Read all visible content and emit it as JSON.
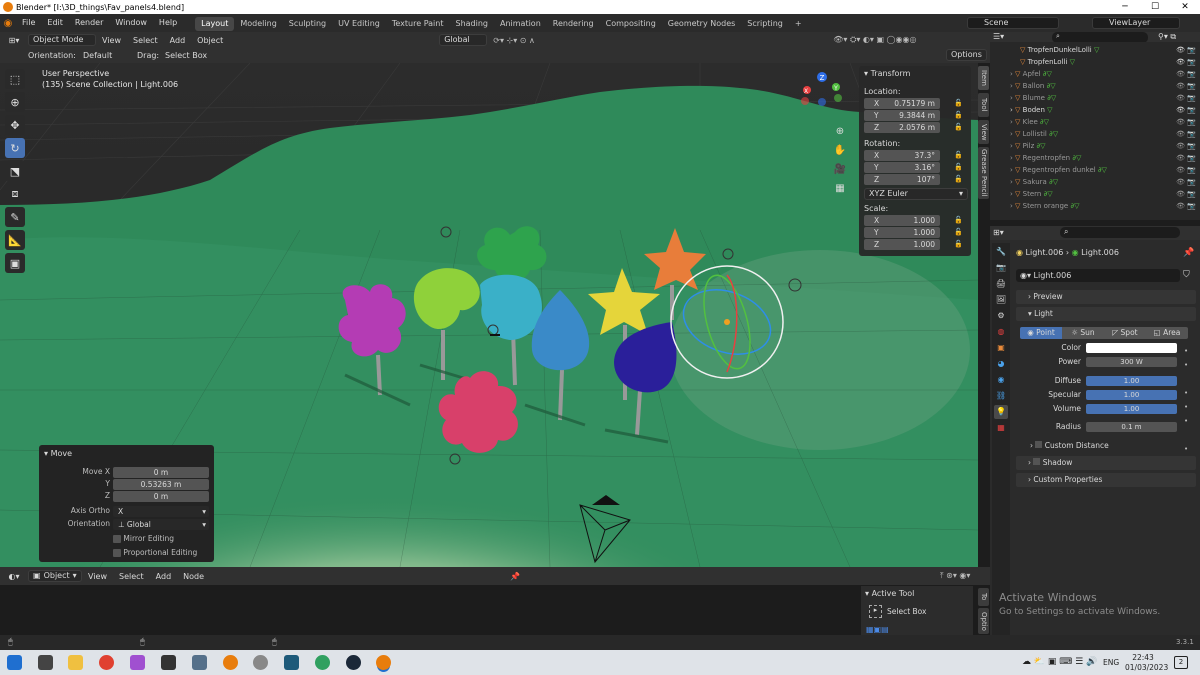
{
  "window": {
    "title": "Blender* [I:\\3D_things\\Fav_panels4.blend]",
    "minimize": "─",
    "maximize": "☐",
    "close": "✕"
  },
  "menu": [
    "File",
    "Edit",
    "Render",
    "Window",
    "Help"
  ],
  "workspaces": [
    "Layout",
    "Modeling",
    "Sculpting",
    "UV Editing",
    "Texture Paint",
    "Shading",
    "Animation",
    "Rendering",
    "Compositing",
    "Geometry Nodes",
    "Scripting"
  ],
  "active_workspace": "Layout",
  "add_workspace": "+",
  "scene": {
    "label": "Scene",
    "view_layer": "ViewLayer"
  },
  "viewport_header": {
    "mode": "Object Mode",
    "menus": [
      "View",
      "Select",
      "Add",
      "Object"
    ],
    "transform_orientation": "Global"
  },
  "viewport_header2": {
    "orientation_label": "Orientation:",
    "orientation_value": "Default",
    "drag_label": "Drag:",
    "drag_value": "Select Box",
    "options": "Options"
  },
  "viewport_info": {
    "line1": "User Perspective",
    "line2": "(135) Scene Collection | Light.006"
  },
  "gizmo_axes": {
    "x": "X",
    "y": "Y",
    "z": "Z"
  },
  "transform": {
    "title": "Transform",
    "location_label": "Location:",
    "location": [
      {
        "axis": "X",
        "value": "0.75179 m"
      },
      {
        "axis": "Y",
        "value": "9.3844 m"
      },
      {
        "axis": "Z",
        "value": "2.0576 m"
      }
    ],
    "rotation_label": "Rotation:",
    "rotation": [
      {
        "axis": "X",
        "value": "37.3°"
      },
      {
        "axis": "Y",
        "value": "3.16°"
      },
      {
        "axis": "Z",
        "value": "107°"
      }
    ],
    "rotation_mode": "XYZ Euler",
    "scale_label": "Scale:",
    "scale": [
      {
        "axis": "X",
        "value": "1.000"
      },
      {
        "axis": "Y",
        "value": "1.000"
      },
      {
        "axis": "Z",
        "value": "1.000"
      }
    ]
  },
  "sidebar_tabs": [
    "Item",
    "Tool",
    "View",
    "Grease Pencil"
  ],
  "move_panel": {
    "title": "Move",
    "move_x_label": "Move X",
    "move_x": "0 m",
    "y_label": "Y",
    "y": "0.53263 m",
    "z_label": "Z",
    "z": "0 m",
    "axis_ortho_label": "Axis Ortho",
    "axis_ortho": "X",
    "orientation_label": "Orientation",
    "orientation": "Global",
    "mirror_editing": "Mirror Editing",
    "proportional_editing": "Proportional Editing"
  },
  "outliner_items": [
    "TropfenDunkelLolli",
    "TropfenLolli",
    "Apfel",
    "Ballon",
    "Blume",
    "Boden",
    "Klee",
    "Lollistil",
    "Pilz",
    "Regentropfen",
    "Regentropfen dunkel",
    "Sakura",
    "Stern",
    "Stern orange"
  ],
  "properties": {
    "breadcrumb1": "Light.006",
    "breadcrumb2": "Light.006",
    "data_name": "Light.006",
    "preview": "Preview",
    "light": "Light",
    "types": [
      "Point",
      "Sun",
      "Spot",
      "Area"
    ],
    "active_type": "Point",
    "color_label": "Color",
    "power_label": "Power",
    "power": "300 W",
    "diffuse_label": "Diffuse",
    "diffuse": "1.00",
    "specular_label": "Specular",
    "specular": "1.00",
    "volume_label": "Volume",
    "volume": "1.00",
    "radius_label": "Radius",
    "radius": "0.1 m",
    "custom_distance": "Custom Distance",
    "shadow": "Shadow",
    "custom_properties": "Custom Properties",
    "light_color": "#ffffff"
  },
  "node_header": {
    "mode": "Object",
    "menus": [
      "View",
      "Select",
      "Add",
      "Node"
    ]
  },
  "active_tool": {
    "title": "Active Tool",
    "tool": "Select Box",
    "tabs": [
      "To",
      "Optio"
    ]
  },
  "version": "3.3.1",
  "activate_windows": {
    "line1": "Activate Windows",
    "line2": "Go to Settings to activate Windows."
  },
  "taskbar": {
    "lang": "ENG",
    "time": "22:43",
    "date": "01/03/2023",
    "notifications": "2"
  },
  "colors": {
    "accent": "#4772b3",
    "ground": "#2f8a5a",
    "header": "#303030"
  }
}
